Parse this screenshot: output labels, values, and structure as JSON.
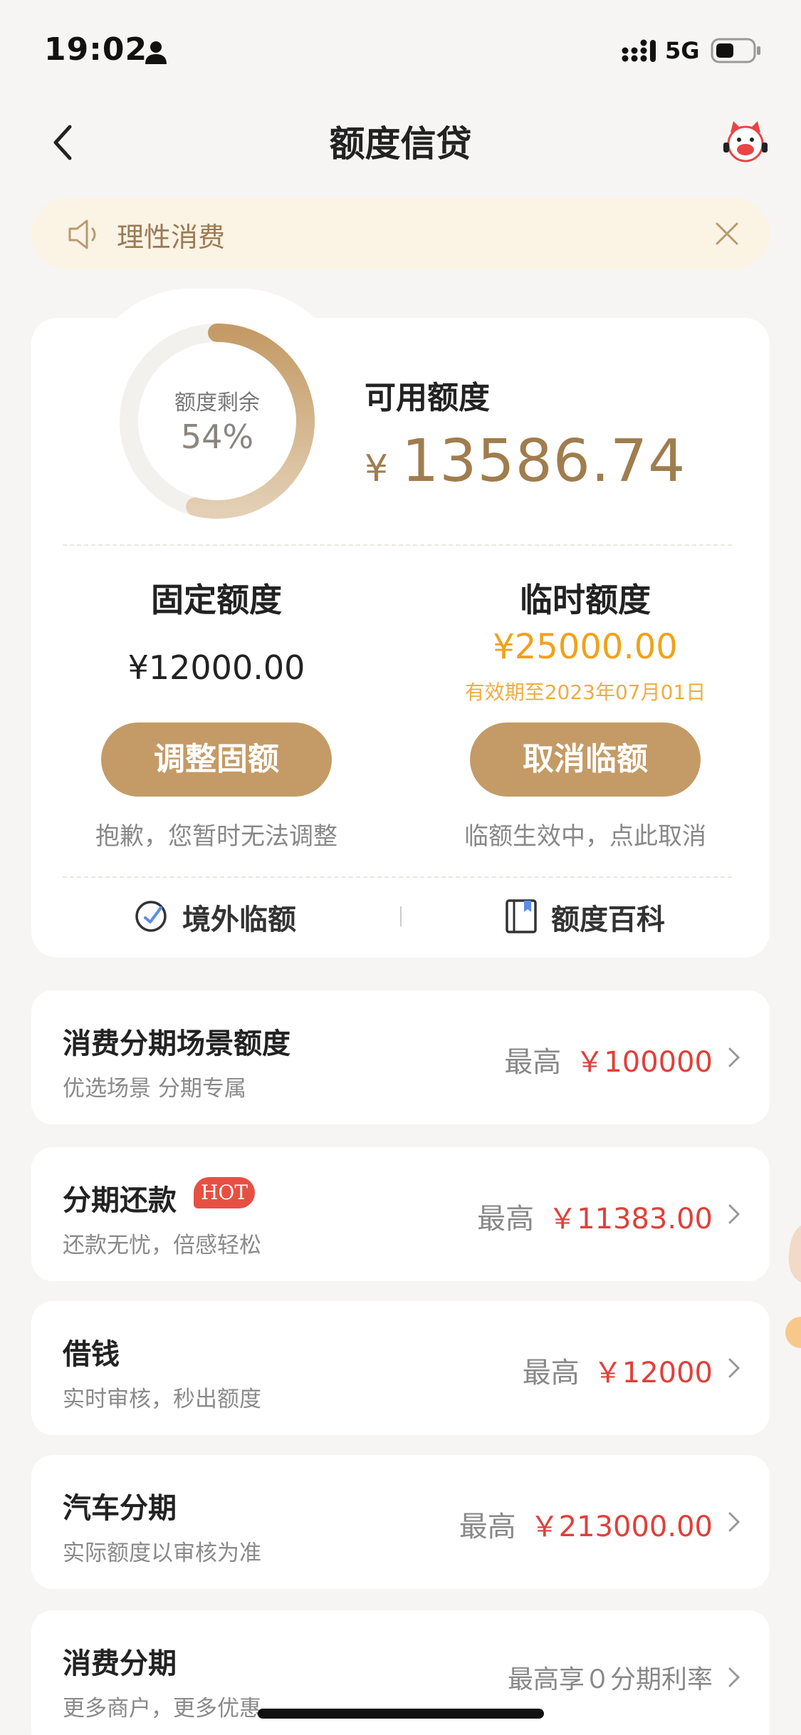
{
  "status_bar": {
    "time": "19:02",
    "network": "5G"
  },
  "nav": {
    "title": "额度信贷"
  },
  "notice": {
    "text": "理性消费"
  },
  "quota": {
    "ring_label": "额度剩余",
    "ring_percent_text": "54%",
    "ring_percent": 0.54,
    "available_label": "可用额度",
    "currency": "¥",
    "available_amount": "13586.74",
    "fixed": {
      "title": "固定额度",
      "amount": "¥12000.00",
      "button": "调整固额",
      "hint": "抱歉，您暂时无法调整"
    },
    "temporary": {
      "title": "临时额度",
      "amount": "¥25000.00",
      "valid_until": "有效期至2023年07月01日",
      "button": "取消临额",
      "hint": "临额生效中，点此取消"
    },
    "links": {
      "overseas": "境外临额",
      "encyclopedia": "额度百科"
    }
  },
  "list": [
    {
      "title": "消费分期场景额度",
      "subtitle": "优选场景 分期专属",
      "prefix": "最高",
      "amount": "￥100000"
    },
    {
      "title": "分期还款",
      "badge": "HOT",
      "subtitle": "还款无忧，倍感轻松",
      "prefix": "最高",
      "amount": "￥11383.00"
    },
    {
      "title": "借钱",
      "subtitle": "实时审核，秒出额度",
      "prefix": "最高",
      "amount": "￥12000"
    },
    {
      "title": "汽车分期",
      "subtitle": "实际额度以审核为准",
      "prefix": "最高",
      "amount": "￥213000.00"
    },
    {
      "title": "消费分期",
      "subtitle": "更多商户，更多优惠",
      "prefix": "最高享０分期利率",
      "amount": ""
    }
  ],
  "colors": {
    "accent": "#c49b66",
    "gold_text": "#a07d4e",
    "temp": "#f0a21a",
    "red": "#e0403a",
    "hot": "#e65043"
  }
}
